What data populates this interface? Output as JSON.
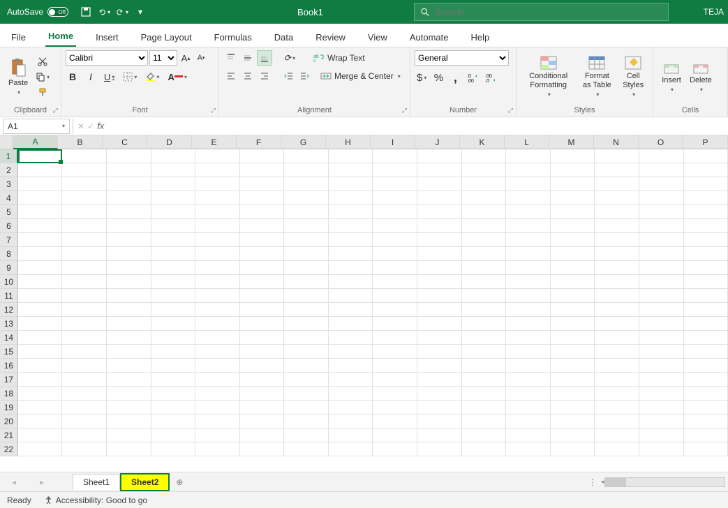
{
  "title_bar": {
    "autosave_label": "AutoSave",
    "autosave_state": "Off",
    "book_title": "Book1",
    "search_placeholder": "Search",
    "user": "TEJA"
  },
  "tabs": [
    "File",
    "Home",
    "Insert",
    "Page Layout",
    "Formulas",
    "Data",
    "Review",
    "View",
    "Automate",
    "Help"
  ],
  "active_tab": "Home",
  "ribbon": {
    "clipboard": {
      "paste": "Paste",
      "label": "Clipboard"
    },
    "font": {
      "name": "Calibri",
      "size": "11",
      "label": "Font"
    },
    "alignment": {
      "wrap": "Wrap Text",
      "merge": "Merge & Center",
      "label": "Alignment"
    },
    "number": {
      "format": "General",
      "label": "Number"
    },
    "styles": {
      "conditional": "Conditional Formatting",
      "table": "Format as Table",
      "cell": "Cell Styles",
      "label": "Styles"
    },
    "cells": {
      "insert": "Insert",
      "delete": "Delete",
      "label": "Cells"
    }
  },
  "formula_bar": {
    "name_box": "A1",
    "formula": ""
  },
  "columns": [
    "A",
    "B",
    "C",
    "D",
    "E",
    "F",
    "G",
    "H",
    "I",
    "J",
    "K",
    "L",
    "M",
    "N",
    "O",
    "P"
  ],
  "rows": [
    1,
    2,
    3,
    4,
    5,
    6,
    7,
    8,
    9,
    10,
    11,
    12,
    13,
    14,
    15,
    16,
    17,
    18,
    19,
    20,
    21,
    22
  ],
  "active_cell": {
    "row": 1,
    "col": "A"
  },
  "sheets": [
    "Sheet1",
    "Sheet2"
  ],
  "active_sheet": "Sheet2",
  "status": {
    "ready": "Ready",
    "accessibility": "Accessibility: Good to go"
  }
}
